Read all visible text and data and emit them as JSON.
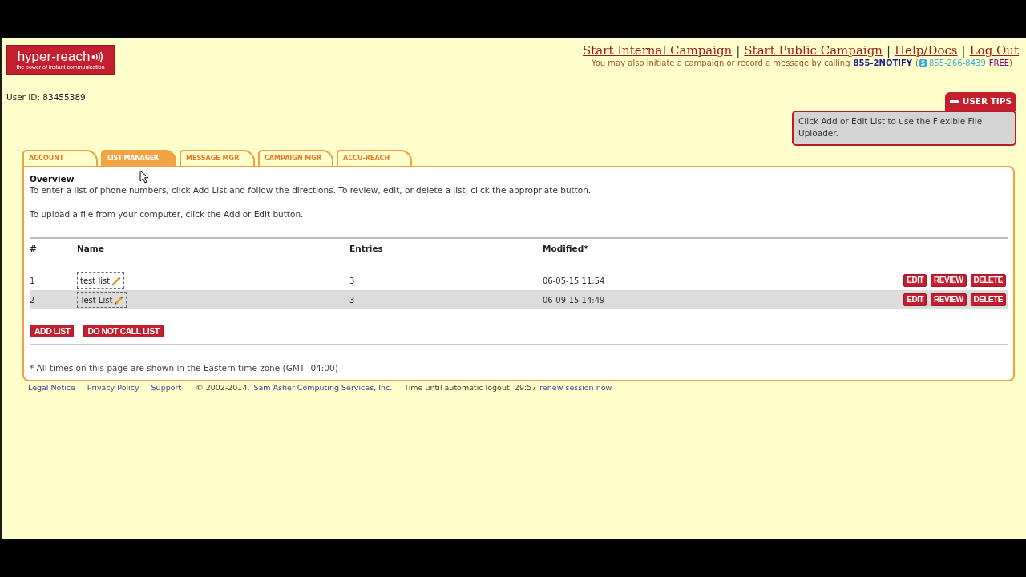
{
  "logo": {
    "wordmark": "hyper-reach",
    "tagline": "the power of instant communication"
  },
  "header_links": [
    "Start Internal Campaign",
    "Start Public Campaign",
    "Help/Docs",
    "Log Out"
  ],
  "link_separator": "|",
  "call_note": [
    {
      "kind": "plain",
      "text": "You may also initiate a campaign or record a message by calling"
    },
    {
      "kind": "number",
      "text": "855-2NOTIFY"
    },
    {
      "kind": "open",
      "text": "("
    },
    {
      "kind": "voip",
      "text": "855-266-8439"
    },
    {
      "kind": "free",
      "text": "FREE"
    },
    {
      "kind": "close",
      "text": ")"
    }
  ],
  "user_id": "User ID: 83455389",
  "user_tips": {
    "title": "USER TIPS",
    "expanded": true,
    "text": "Click Add or Edit List to use the Flexible File Uploader."
  },
  "tabs": [
    {
      "label": "ACCOUNT",
      "selected": false
    },
    {
      "label": "LIST MANAGER",
      "selected": true
    },
    {
      "label": "MESSAGE MGR",
      "selected": false
    },
    {
      "label": "CAMPAIGN MGR",
      "selected": false
    },
    {
      "label": "ACCU-REACH",
      "selected": false
    }
  ],
  "overview": {
    "heading": "Overview",
    "paragraphs": [
      "To enter a list of phone numbers, click Add List and follow the directions. To review, edit, or delete a list, click the appropriate button.",
      "To upload a file from your computer, click the Add or Edit button."
    ]
  },
  "table": {
    "columns": [
      "#",
      "Name",
      "Entries",
      "Modified*"
    ],
    "rows": [
      {
        "number": "1",
        "name": "test list",
        "entries": "3",
        "modified": "06-05-15 11:54",
        "actions": [
          "EDIT",
          "REVIEW",
          "DELETE"
        ]
      },
      {
        "number": "2",
        "name": "Test List",
        "entries": "3",
        "modified": "06-09-15 14:49",
        "actions": [
          "EDIT",
          "REVIEW",
          "DELETE"
        ]
      }
    ]
  },
  "list_buttons": [
    "ADD LIST",
    "DO NOT CALL LIST"
  ],
  "footnote": "* All times on this page are shown in the Eastern time zone (GMT -04:00)",
  "footer": {
    "links": [
      "Legal Notice",
      "Privacy Policy",
      "Support"
    ],
    "copyright": "© 2002-2014,",
    "company": "Sam Asher Computing Services, Inc.",
    "session": "Time until automatic logout: 29:57",
    "renew": "renew session now"
  }
}
